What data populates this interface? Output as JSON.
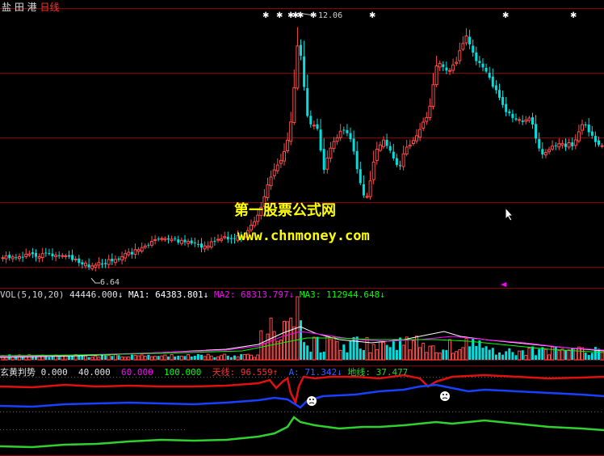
{
  "header": {
    "stock_name": "盐 田 港",
    "period": "日线"
  },
  "price_panel": {
    "high_label": "12.06",
    "low_label": "6.64",
    "colors": {
      "up": "#ff4a4a",
      "down": "#00e0e0",
      "grid": "#8a0000"
    }
  },
  "watermark": {
    "line1": "第一股票公式网",
    "line2": "www.chnmoney.com"
  },
  "vol_panel": {
    "indicator": "VOL(5,10,20)",
    "value": "44446.000↓",
    "ma1": "MA1: 64383.801↓",
    "ma2": "MA2: 68313.797↓",
    "ma3": "MA3: 112944.648↓"
  },
  "osc_panel": {
    "indicator": "玄黄判势",
    "v1": "0.000",
    "v2": "40.000",
    "v3": "60.000",
    "v4": "100.000",
    "tian": "天线: 96.559↑",
    "a": "A: 71.342↓",
    "di": "地线: 37.477"
  }
}
